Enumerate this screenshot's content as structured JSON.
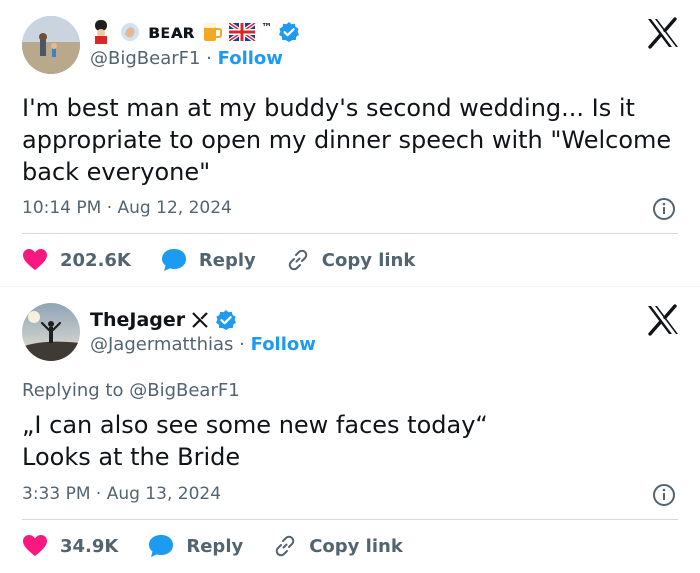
{
  "tweets": [
    {
      "display_name": "ʙᴇᴀʀ",
      "display_name_extra": "™",
      "handle": "@BigBearF1",
      "separator": "·",
      "follow_label": "Follow",
      "text": "I'm best man at my buddy's second wedding... Is it appropriate to open my dinner speech with \"Welcome back everyone\"",
      "timestamp": "10:14 PM · Aug 12, 2024",
      "likes": "202.6K",
      "reply_label": "Reply",
      "copy_label": "Copy link",
      "verified_color": "#1d9bf0",
      "like_color": "#f91880",
      "reply_color": "#1d9bf0"
    },
    {
      "display_name": "TheJager",
      "handle": "@Jagermatthias",
      "separator": "·",
      "follow_label": "Follow",
      "replying_to_prefix": "Replying to",
      "replying_to_handle": "@BigBearF1",
      "text": "„I can also see some new faces today“\nLooks at the Bride",
      "timestamp": "3:33 PM · Aug 13, 2024",
      "likes": "34.9K",
      "reply_label": "Reply",
      "copy_label": "Copy link",
      "verified_color": "#1d9bf0",
      "like_color": "#f91880",
      "reply_color": "#1d9bf0"
    }
  ],
  "icons": {
    "avatar1": "profile-photo-beach",
    "avatar2": "profile-photo-silhouette",
    "logo": "x-logo",
    "verified": "verified-badge-icon",
    "info": "info-icon",
    "like": "heart-icon",
    "reply": "speech-bubble-icon",
    "copy": "link-icon",
    "emoji_set1": [
      "guard-emoji",
      "waving-hand-emoji",
      "beer-emoji",
      "uk-flag-emoji"
    ],
    "emoji_set2": [
      "x-mark-emoji"
    ]
  }
}
